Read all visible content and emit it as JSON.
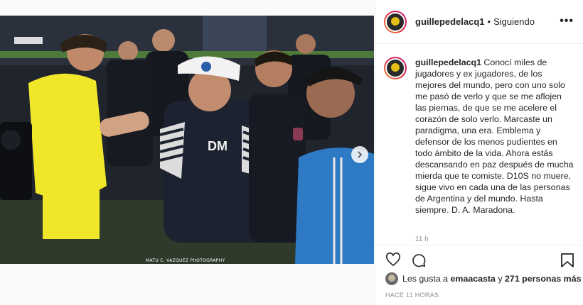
{
  "post": {
    "username": "guillepedelacq1",
    "follow_status": "Siguiendo",
    "separator": "•",
    "more_label": "•••",
    "caption": "Conocí miles de jugadores y ex jugadores, de los mejores del mundo, pero con uno solo me pasó de verlo y que se me aflojen las piernas, de que se me acelere el corazón de solo verlo. Marcaste un paradigma, una era. Emblema y defensor de los menos pudientes en todo ámbito de la vida. Ahora estás descansando en paz después de mucha mierda que te comiste. D10S no muere, sigue vivo en cada una de las personas de Argentina y del mundo. Hasta siempre. D. A. Maradona.",
    "caption_time": "11 h",
    "likes_prefix": "Les gusta a",
    "likes_user": "emaacasta",
    "likes_mid": "y",
    "likes_count": "271 personas más",
    "posted_ago": "HACE 11 HORAS",
    "watermark": "MATU C. VAZQUEZ    PHOTOGRAPHY",
    "colors": {
      "jersey_yellow": "#f0e62a",
      "dark_jersey": "#1d2230",
      "sky_blue": "#2f7ac4"
    }
  }
}
